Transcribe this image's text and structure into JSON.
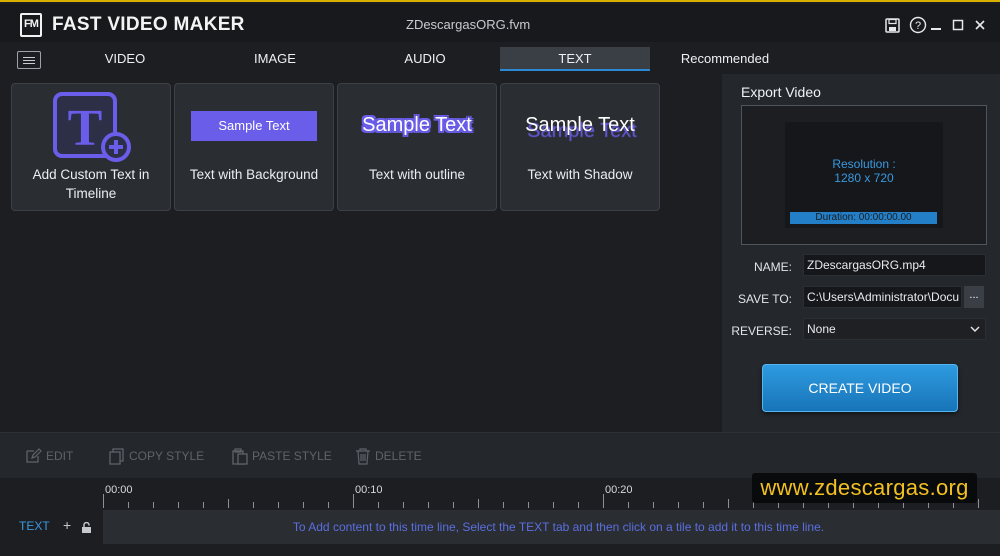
{
  "app": {
    "logo_text": "FM",
    "name": "FAST VIDEO MAKER",
    "file_name": "ZDescargasORG.fvm"
  },
  "window_controls": [
    "save-icon",
    "help-icon",
    "minimize-icon",
    "maximize-icon",
    "close-icon"
  ],
  "tabs": [
    {
      "label": "VIDEO",
      "active": false
    },
    {
      "label": "IMAGE",
      "active": false
    },
    {
      "label": "AUDIO",
      "active": false
    },
    {
      "label": "TEXT",
      "active": true
    },
    {
      "label": "Recommended",
      "active": false
    }
  ],
  "tiles": [
    {
      "label": "Add Custom Text in Timeline",
      "icon": "add-text-icon"
    },
    {
      "label": "Text with Background",
      "sample": "Sample Text"
    },
    {
      "label": "Text with outline",
      "sample": "Sample Text"
    },
    {
      "label": "Text with Shadow",
      "sample": "Sample Text"
    }
  ],
  "export": {
    "title": "Export Video",
    "resolution_label": "Resolution :",
    "resolution_value": "1280 x 720",
    "duration": "Duration: 00:00:00.00",
    "name_label": "NAME:",
    "name_value": "ZDescargasORG.mp4",
    "save_label": "SAVE TO:",
    "save_value": "C:\\Users\\Administrator\\Docu",
    "browse_label": "...",
    "reverse_label": "REVERSE:",
    "reverse_value": "None",
    "create_label": "CREATE VIDEO"
  },
  "toolbar": {
    "edit": "EDIT",
    "copy_style": "COPY STYLE",
    "paste_style": "PASTE STYLE",
    "delete": "DELETE"
  },
  "timeline": {
    "time_labels": [
      "00:00",
      "00:10",
      "00:20"
    ],
    "track_label": "TEXT",
    "track_add": "+",
    "empty_message": "To Add content to this time line, Select the TEXT tab and then click on a tile to add it to this time line."
  },
  "watermark": "www.zdescargas.org",
  "colors": {
    "accent_blue": "#2b89d6",
    "sample_purple": "#6a5de9",
    "watermark_yellow": "#f3c021",
    "window_border": "#d9b000"
  }
}
